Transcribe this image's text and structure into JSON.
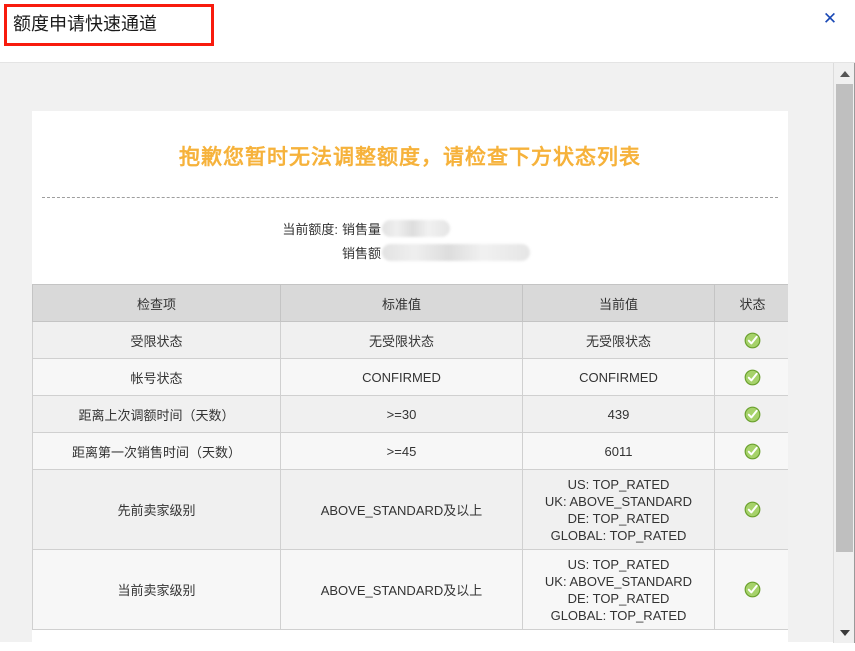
{
  "window": {
    "title": "额度申请快速通道",
    "close_label": "✕",
    "annotation_color": "#f81b0d"
  },
  "content": {
    "headline": "抱歉您暂时无法调整额度，请检查下方状态列表",
    "headline_color": "#f6b23b",
    "quota": {
      "label": "当前额度:",
      "rows": [
        {
          "key": "销售量",
          "value": "",
          "redacted": true,
          "size": "small"
        },
        {
          "key": "销售额",
          "value": "",
          "redacted": true,
          "size": "large"
        }
      ]
    },
    "table": {
      "headers": [
        "检查项",
        "标准值",
        "当前值",
        "状态"
      ],
      "rows": [
        {
          "item": "受限状态",
          "standard": "无受限状态",
          "current": "无受限状态",
          "status": "ok"
        },
        {
          "item": "帐号状态",
          "standard": "CONFIRMED",
          "current": "CONFIRMED",
          "status": "ok"
        },
        {
          "item": "距离上次调额时间（天数）",
          "standard": ">=30",
          "current": "439",
          "status": "ok"
        },
        {
          "item": "距离第一次销售时间（天数）",
          "standard": ">=45",
          "current": "6011",
          "status": "ok"
        },
        {
          "item": "先前卖家级别",
          "standard": "ABOVE_STANDARD及以上",
          "current": "US: TOP_RATED\nUK: ABOVE_STANDARD\nDE: TOP_RATED\nGLOBAL: TOP_RATED",
          "status": "ok"
        },
        {
          "item": "当前卖家级别",
          "standard": "ABOVE_STANDARD及以上",
          "current": "US: TOP_RATED\nUK: ABOVE_STANDARD\nDE: TOP_RATED\nGLOBAL: TOP_RATED",
          "status": "ok"
        }
      ],
      "status_icon_color": "#7dbb42"
    }
  },
  "scrollbar": {
    "up_arrow": "▲",
    "down_arrow": "▼"
  }
}
